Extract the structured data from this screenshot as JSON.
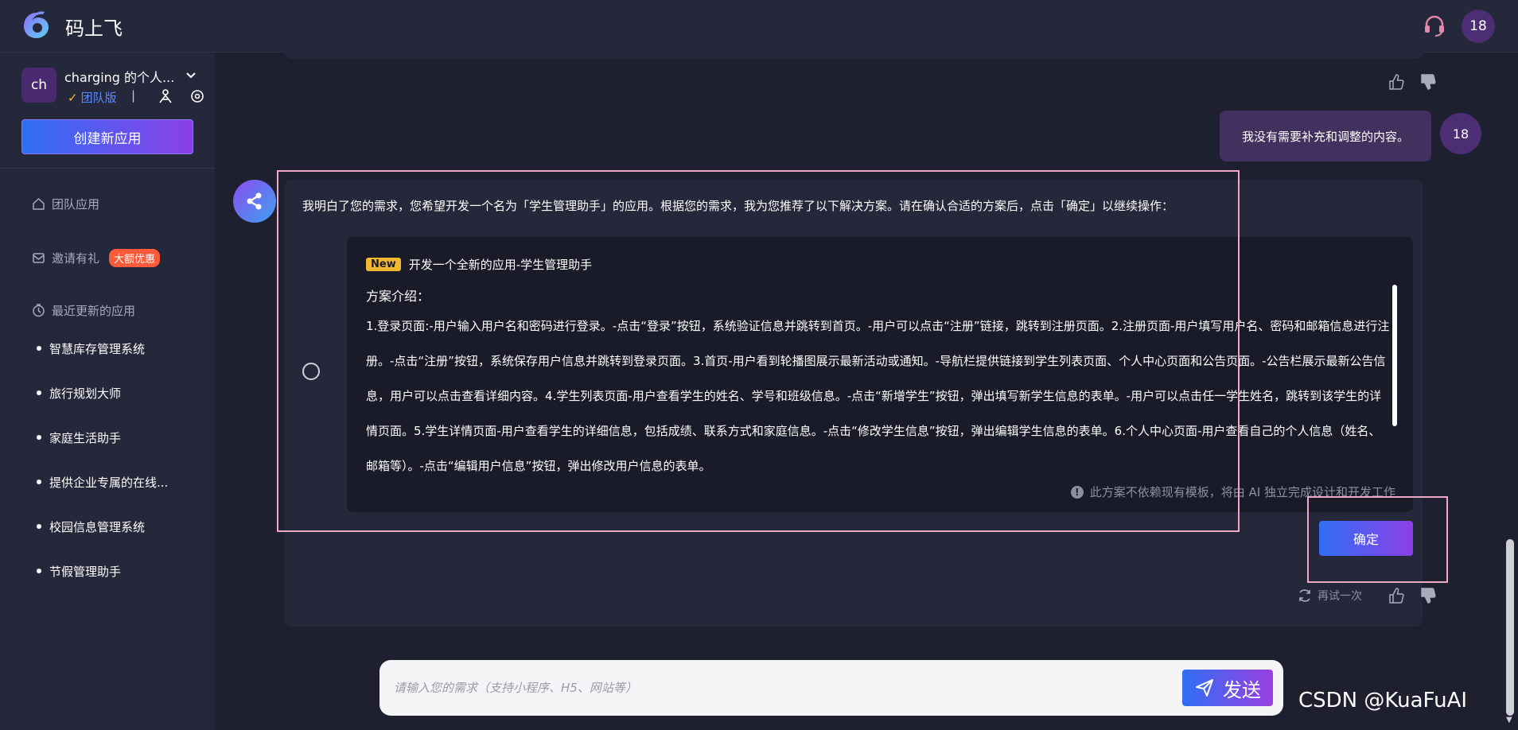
{
  "app": {
    "brand": "码上飞"
  },
  "topbar": {
    "user_avatar": "18"
  },
  "workspace": {
    "avatar": "ch",
    "name": "charging 的个人...",
    "badge": "团队版",
    "separator": "|"
  },
  "sidebar": {
    "create_button": "创建新应用",
    "nav_team": "团队应用",
    "nav_invite": "邀请有礼",
    "promo_badge": "大额优惠",
    "nav_recent": "最近更新的应用",
    "apps": [
      "智慧库存管理系统",
      "旅行规划大师",
      "家庭生活助手",
      "提供企业专属的在线...",
      "校园信息管理系统",
      "节假管理助手"
    ]
  },
  "chat": {
    "user_message": "我没有需要补充和调整的内容。",
    "user_avatar": "18",
    "bot_intro": "我明白了您的需求，您希望开发一个名为「学生管理助手」的应用。根据您的需求，我为您推荐了以下解决方案。请在确认合适的方案后，点击「确定」以继续操作：",
    "plan": {
      "badge": "New",
      "title": "开发一个全新的应用-学生管理助手",
      "subtitle": "方案介绍：",
      "body": "1.登录页面:-用户输入用户名和密码进行登录。-点击“登录”按钮，系统验证信息并跳转到首页。-用户可以点击“注册”链接，跳转到注册页面。2.注册页面-用户填写用户名、密码和邮箱信息进行注册。-点击“注册”按钮，系统保存用户信息并跳转到登录页面。3.首页-用户看到轮播图展示最新活动或通知。-导航栏提供链接到学生列表页面、个人中心页面和公告页面。-公告栏展示最新公告信息，用户可以点击查看详细内容。4.学生列表页面-用户查看学生的姓名、学号和班级信息。-点击“新增学生”按钮，弹出填写新学生信息的表单。-用户可以点击任一学生姓名，跳转到该学生的详情页面。5.学生详情页面-用户查看学生的详细信息，包括成绩、联系方式和家庭信息。-点击“修改学生信息”按钮，弹出编辑学生信息的表单。6.个人中心页面-用户查看自己的个人信息（姓名、邮箱等）。-点击“编辑用户信息”按钮，弹出修改用户信息的表单。",
      "note": "此方案不依赖现有模板，将由 AI 独立完成设计和开发工作"
    },
    "confirm_button": "确定",
    "retry_label": "再试一次"
  },
  "composer": {
    "placeholder": "请输入您的需求（支持小程序、H5、网站等）",
    "send_label": "发送"
  },
  "watermark": "CSDN @KuaFuAI"
}
